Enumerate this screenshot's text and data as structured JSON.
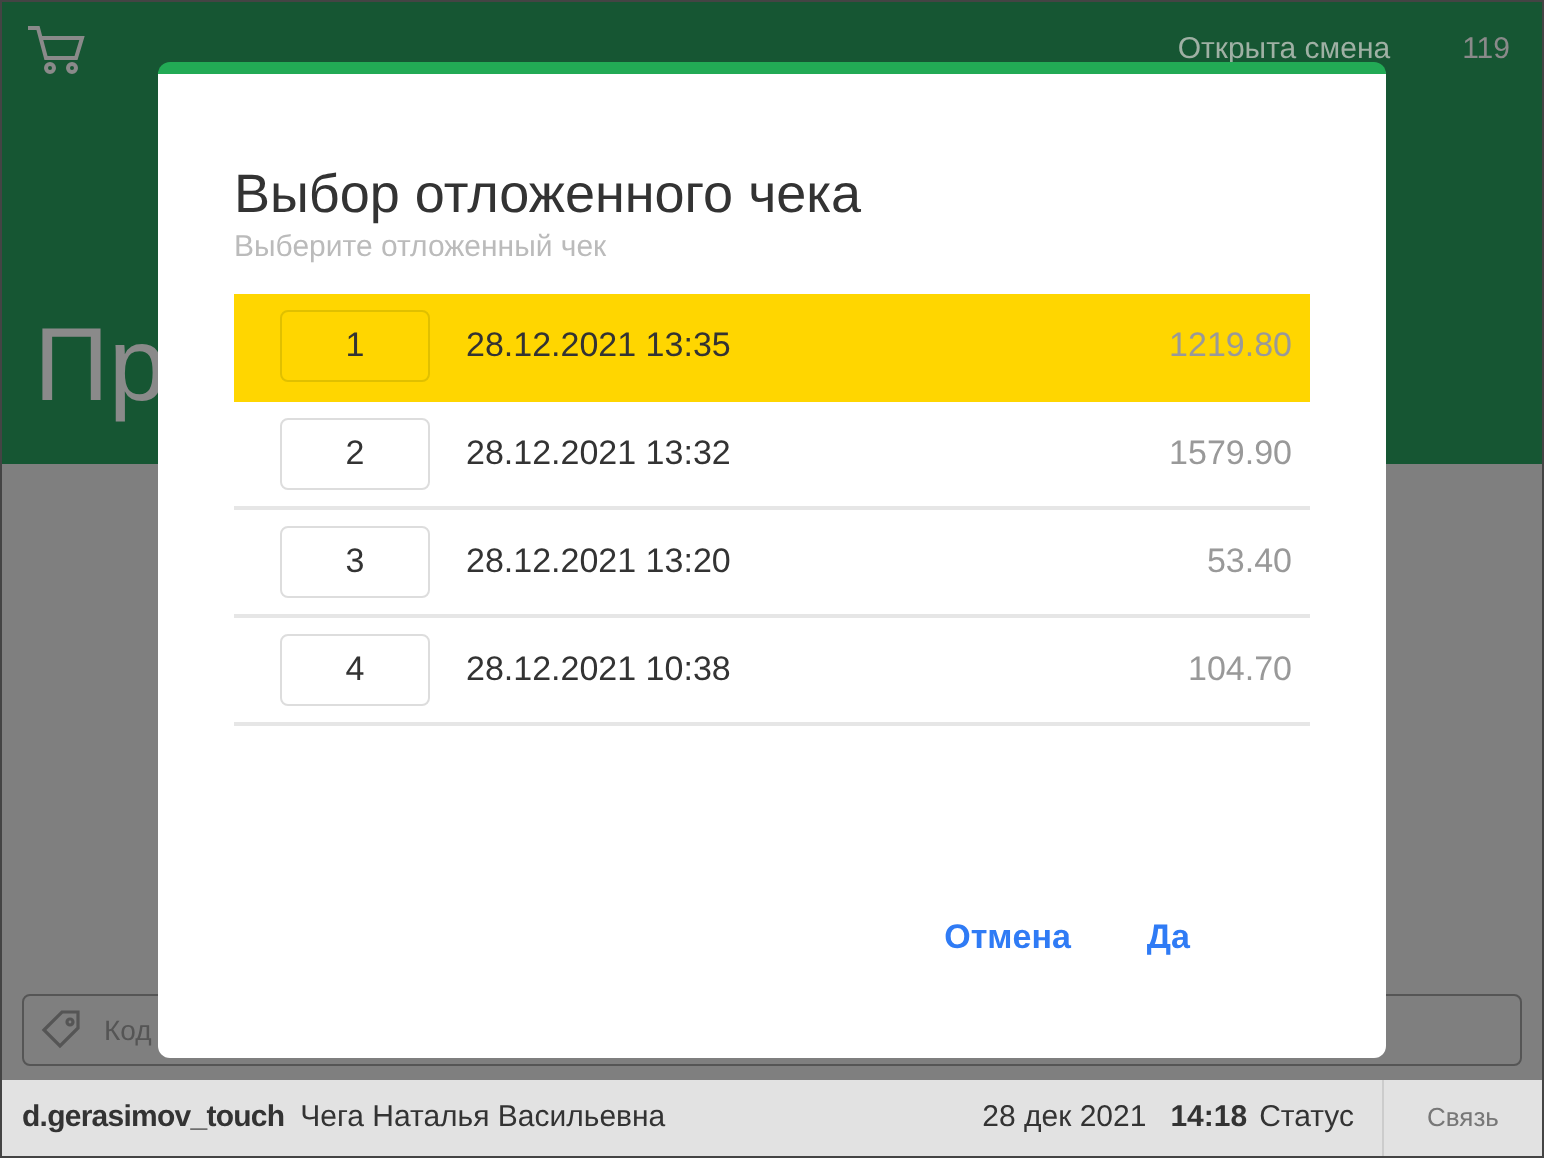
{
  "header": {
    "shift_status": "Открыта смена",
    "shift_number": "119",
    "page_title": "Пр"
  },
  "search": {
    "placeholder": "Код"
  },
  "dialog": {
    "title": "Выбор отложенного чека",
    "subtitle": "Выберите отложенный чек",
    "receipts": [
      {
        "number": "1",
        "datetime": "28.12.2021 13:35",
        "amount": "1219.80",
        "selected": true
      },
      {
        "number": "2",
        "datetime": "28.12.2021 13:32",
        "amount": "1579.90",
        "selected": false
      },
      {
        "number": "3",
        "datetime": "28.12.2021 13:20",
        "amount": "53.40",
        "selected": false
      },
      {
        "number": "4",
        "datetime": "28.12.2021 10:38",
        "amount": "104.70",
        "selected": false
      }
    ],
    "buttons": [
      "Отмена",
      "Да"
    ]
  },
  "status_bar": {
    "login": "d.gerasimov_touch",
    "user_name": "Чега Наталья Васильевна",
    "date": "28 дек 2021",
    "time": "14:18",
    "status": "Статус",
    "connection": "Связь"
  }
}
